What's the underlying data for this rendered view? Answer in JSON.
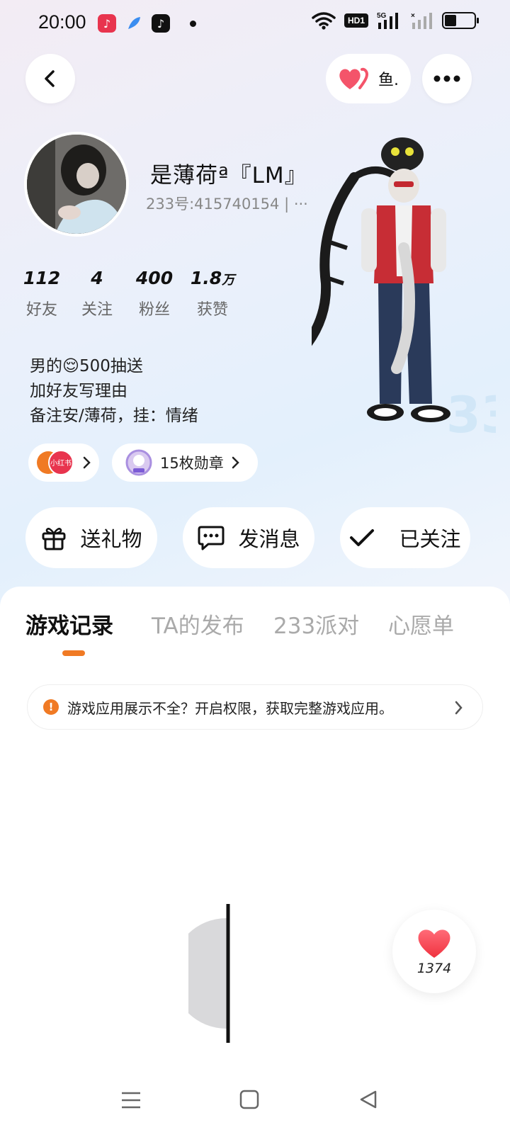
{
  "status_bar": {
    "time": "20:00",
    "network": "5G",
    "hd_label": "HD1",
    "battery_level": 0.4
  },
  "header": {
    "back_icon": "chevron-left-icon",
    "like_icon": "heart-icon",
    "like_label": "鱼.",
    "more_icon": "more-dots-icon"
  },
  "profile": {
    "nickname": "是薄荷ª『LM』",
    "uid": "233号:415740154 | ···",
    "stats": [
      {
        "num": "112",
        "unit": "",
        "label": "好友"
      },
      {
        "num": "4",
        "unit": "",
        "label": "关注"
      },
      {
        "num": "400",
        "unit": "",
        "label": "粉丝"
      },
      {
        "num": "1.8",
        "unit": "万",
        "label": "获赞"
      }
    ],
    "bio": [
      "男的😌500抽送",
      "加好友写理由",
      "备注安/薄荷，挂：情绪"
    ],
    "xiaohongshu_label": "小红书",
    "medals_label": "15枚勋章"
  },
  "actions": [
    {
      "label": "送礼物",
      "icon": "gift-icon"
    },
    {
      "label": "发消息",
      "icon": "message-icon"
    },
    {
      "label": "已关注",
      "icon": "check-icon"
    }
  ],
  "tabs": [
    {
      "label": "游戏记录",
      "active": true
    },
    {
      "label": "TA的发布",
      "active": false
    },
    {
      "label": "233派对",
      "active": false
    },
    {
      "label": "心愿单",
      "active": false
    }
  ],
  "notice": {
    "text": "游戏应用展示不全？开启权限，获取完整游戏应用。",
    "icon": "warning-icon"
  },
  "floating_like": {
    "count": "1374",
    "icon": "heart-icon"
  },
  "colors": {
    "accent": "#f07a24",
    "heart": "#f4546a"
  }
}
